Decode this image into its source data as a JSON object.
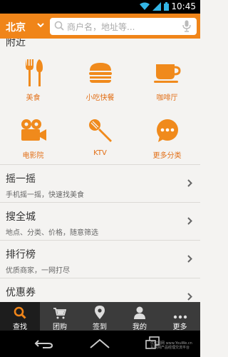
{
  "status_bar": {
    "time": "10:45"
  },
  "header": {
    "city": "北京",
    "search_placeholder": "商户名，地址等..."
  },
  "nearby": {
    "title": "附近",
    "categories": [
      {
        "label": "美食",
        "icon": "fork-knife-icon"
      },
      {
        "label": "小吃快餐",
        "icon": "burger-icon"
      },
      {
        "label": "咖啡厅",
        "icon": "coffee-cup-icon"
      },
      {
        "label": "电影院",
        "icon": "movie-camera-icon"
      },
      {
        "label": "KTV",
        "icon": "microphone-icon"
      },
      {
        "label": "更多分类",
        "icon": "more-bubble-icon"
      }
    ]
  },
  "list": [
    {
      "title": "摇一摇",
      "desc": "手机摇一摇，快速找美食"
    },
    {
      "title": "搜全城",
      "desc": "地点、分类、价格，随意筛选"
    },
    {
      "title": "排行榜",
      "desc": "优质商家，一网打尽"
    },
    {
      "title": "优惠券",
      "desc": ""
    }
  ],
  "tabs": [
    {
      "label": "查找",
      "icon": "search-icon",
      "active": true
    },
    {
      "label": "团购",
      "icon": "cart-icon",
      "active": false
    },
    {
      "label": "签到",
      "icon": "location-pin-icon",
      "active": false
    },
    {
      "label": "我的",
      "icon": "person-icon",
      "active": false
    },
    {
      "label": "更多",
      "icon": "more-dots-icon",
      "active": false
    }
  ],
  "watermark": {
    "line1": "优优图网 www.YouWe.cn",
    "line2": "互联网产品经理交流平台"
  },
  "colors": {
    "accent": "#f08519",
    "icon_orange": "#f08a1c",
    "tabbar": "#3b3b3b",
    "tab_active": "#1d1d1d"
  }
}
